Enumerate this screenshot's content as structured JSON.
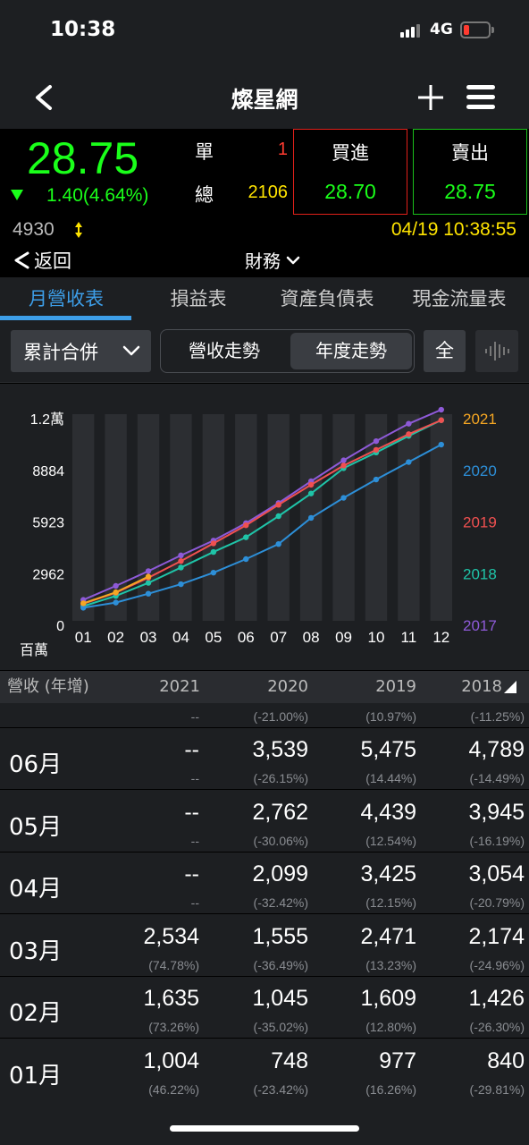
{
  "status": {
    "time": "10:38",
    "network": "4G"
  },
  "nav": {
    "title": "燦星網"
  },
  "quote": {
    "price": "28.75",
    "change": "1.40(4.64%)",
    "single_label": "單",
    "single_value": "1",
    "total_label": "總",
    "total_value": "2106",
    "buy_label": "買進",
    "buy_price": "28.70",
    "sell_label": "賣出",
    "sell_price": "28.75",
    "volume": "4930",
    "datetime": "04/19 10:38:55",
    "return_label": "返回",
    "finance_label": "財務"
  },
  "tabs": [
    "月營收表",
    "損益表",
    "資產負債表",
    "現金流量表"
  ],
  "controls": {
    "combined_select": "累計合併",
    "segments": [
      "營收走勢",
      "年度走勢"
    ],
    "all_label": "全"
  },
  "colors": {
    "2021": "#f5a623",
    "2020": "#2d8fd8",
    "2019": "#f05050",
    "2018": "#1fc4a8",
    "2017": "#8e5ad8",
    "accent": "#3d9ee8",
    "up": "#1aff1a",
    "down_red": "#e0201a",
    "highlight": "#ffe400"
  },
  "chart_data": {
    "type": "line",
    "categories": [
      "01",
      "02",
      "03",
      "04",
      "05",
      "06",
      "07",
      "08",
      "09",
      "10",
      "11",
      "12"
    ],
    "y_ticks": [
      "1.2萬",
      "8884",
      "5923",
      "2962",
      "0"
    ],
    "unit_label": "百萬",
    "ylim": [
      0,
      11846
    ],
    "series": [
      {
        "name": "2021",
        "values": [
          1004,
          1635,
          2534
        ]
      },
      {
        "name": "2020",
        "values": [
          748,
          1045,
          1555,
          2099,
          2762,
          3539,
          4400,
          5900,
          7050,
          8100,
          9100,
          10100
        ]
      },
      {
        "name": "2019",
        "values": [
          977,
          1609,
          2471,
          3425,
          4439,
          5475,
          6650,
          7800,
          8900,
          9800,
          10700,
          11500
        ]
      },
      {
        "name": "2018",
        "values": [
          840,
          1426,
          2174,
          3054,
          3945,
          4789,
          6000,
          7300,
          8750,
          9650,
          10600,
          11500
        ]
      },
      {
        "name": "2017",
        "values": [
          1200,
          2000,
          2850,
          3750,
          4600,
          5600,
          6750,
          8000,
          9200,
          10300,
          11300,
          12100
        ]
      }
    ]
  },
  "table": {
    "header": {
      "label": "營收 (年增)",
      "years": [
        "2021",
        "2020",
        "2019",
        "2018"
      ]
    },
    "partial_row": {
      "pcts": [
        "--",
        "(-21.00%)",
        "(10.97%)",
        "(-11.25%)"
      ]
    },
    "rows": [
      {
        "month": "06月",
        "vals": [
          "--",
          "3,539",
          "5,475",
          "4,789"
        ],
        "pcts": [
          "--",
          "(-26.15%)",
          "(14.44%)",
          "(-14.49%)"
        ]
      },
      {
        "month": "05月",
        "vals": [
          "--",
          "2,762",
          "4,439",
          "3,945"
        ],
        "pcts": [
          "--",
          "(-30.06%)",
          "(12.54%)",
          "(-16.19%)"
        ]
      },
      {
        "month": "04月",
        "vals": [
          "--",
          "2,099",
          "3,425",
          "3,054"
        ],
        "pcts": [
          "--",
          "(-32.42%)",
          "(12.15%)",
          "(-20.79%)"
        ]
      },
      {
        "month": "03月",
        "vals": [
          "2,534",
          "1,555",
          "2,471",
          "2,174"
        ],
        "pcts": [
          "(74.78%)",
          "(-36.49%)",
          "(13.23%)",
          "(-24.96%)"
        ]
      },
      {
        "month": "02月",
        "vals": [
          "1,635",
          "1,045",
          "1,609",
          "1,426"
        ],
        "pcts": [
          "(73.26%)",
          "(-35.02%)",
          "(12.80%)",
          "(-26.30%)"
        ]
      },
      {
        "month": "01月",
        "vals": [
          "1,004",
          "748",
          "977",
          "840"
        ],
        "pcts": [
          "(46.22%)",
          "(-23.42%)",
          "(16.26%)",
          "(-29.81%)"
        ]
      }
    ]
  }
}
